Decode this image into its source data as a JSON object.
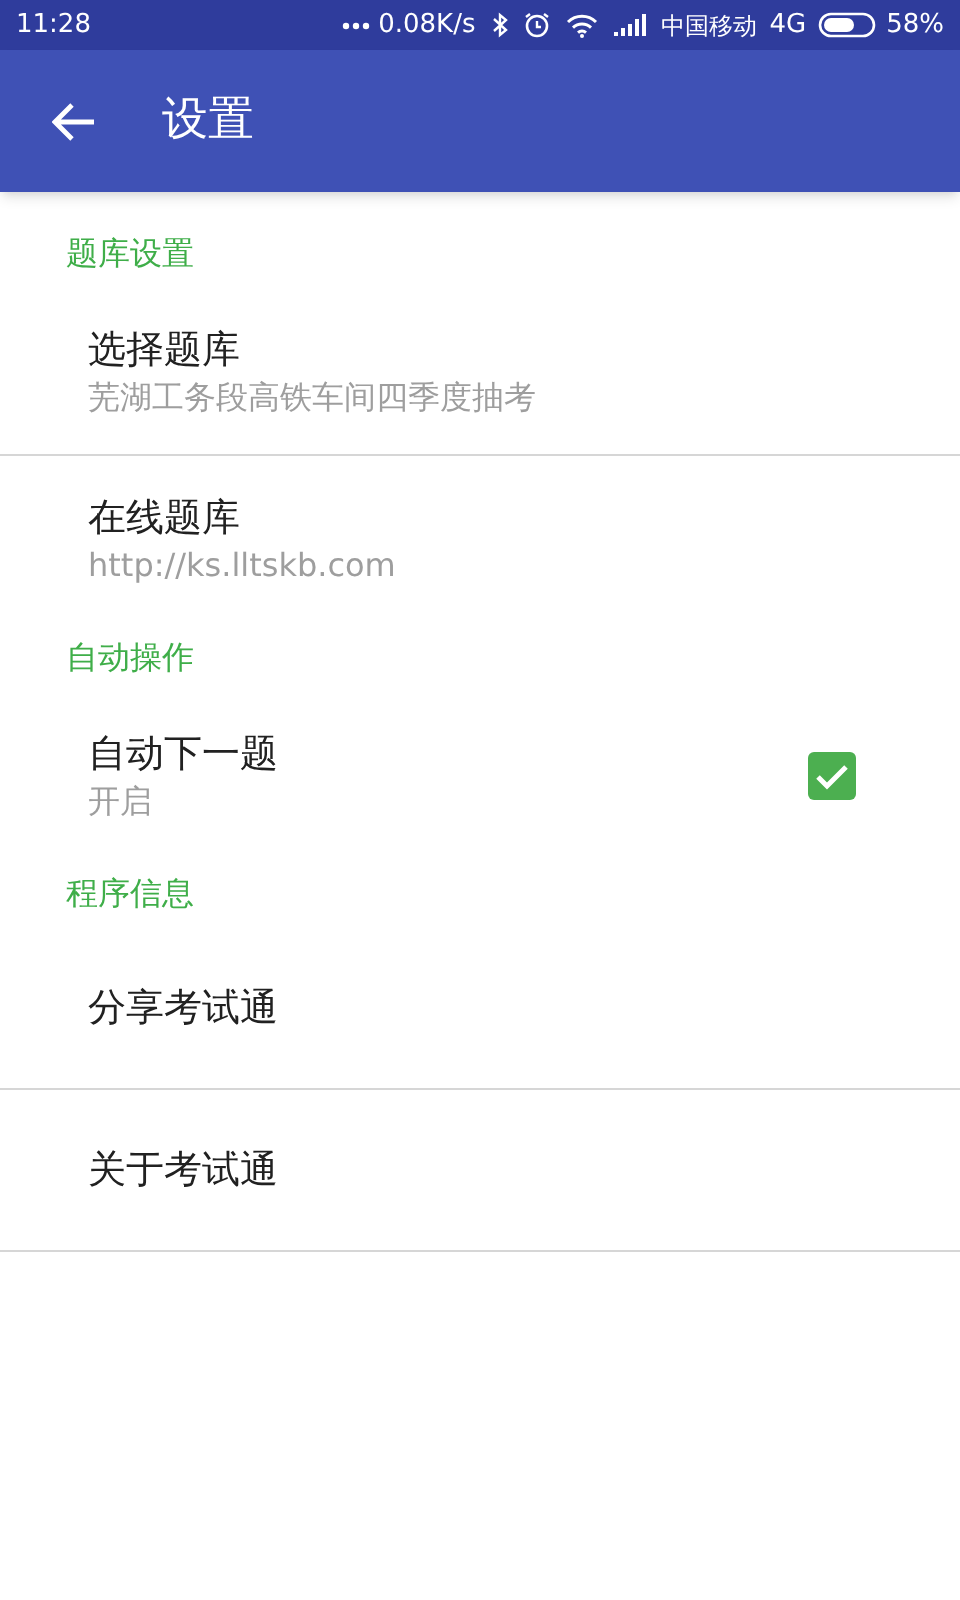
{
  "status_bar": {
    "time": "11:28",
    "speed": "0.08K/s",
    "carrier": "中国移动",
    "network": "4G",
    "battery": "58%"
  },
  "toolbar": {
    "title": "设置"
  },
  "sections": [
    {
      "header": "题库设置",
      "items": [
        {
          "kind": "text",
          "title": "选择题库",
          "summary": "芜湖工务段高铁车间四季度抽考",
          "divider": true
        },
        {
          "kind": "text",
          "title": "在线题库",
          "summary": "http://ks.lltskb.com",
          "divider": false
        }
      ]
    },
    {
      "header": "自动操作",
      "items": [
        {
          "kind": "checkbox",
          "title": "自动下一题",
          "summary": "开启",
          "checked": true,
          "divider": false
        }
      ]
    },
    {
      "header": "程序信息",
      "items": [
        {
          "kind": "text",
          "title": "分享考试通",
          "divider": true
        },
        {
          "kind": "text",
          "title": "关于考试通",
          "divider": true
        }
      ]
    }
  ]
}
